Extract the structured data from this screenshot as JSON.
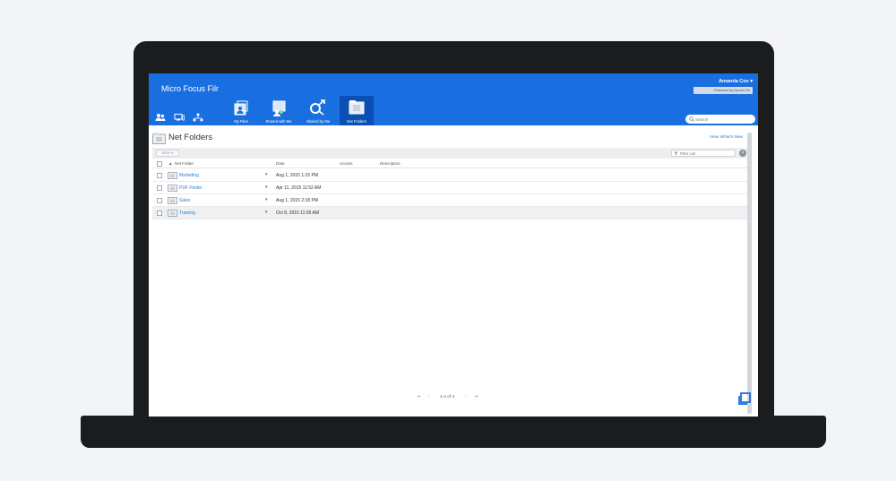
{
  "app": {
    "title": "Micro Focus Filr"
  },
  "user": {
    "name": "Amanda Cox ▾",
    "powered_by": "Powered by Novell Filr"
  },
  "nav_tabs": [
    {
      "label": "My Files",
      "icon": "my-files-icon"
    },
    {
      "label": "Shared with Me",
      "icon": "shared-with-me-icon"
    },
    {
      "label": "Shared by Me",
      "icon": "shared-by-me-icon"
    },
    {
      "label": "Net Folders",
      "icon": "net-folders-icon",
      "active": true
    }
  ],
  "search": {
    "placeholder": "Search"
  },
  "page": {
    "title": "Net Folders",
    "whats_new": "View What's New"
  },
  "toolbar": {
    "more_label": "More ▾",
    "filter_placeholder": "Filter List",
    "clear_label": "×"
  },
  "columns": {
    "sort_arrow": "▲",
    "name": "Net Folder",
    "date": "Date",
    "access": "Access",
    "description": "Description"
  },
  "rows": [
    {
      "name": "Marketing",
      "arrow": "▾",
      "date": "Aug 1, 2015 1:15 PM"
    },
    {
      "name": "PDF Finder",
      "arrow": "▾",
      "date": "Apr 11, 2015 11:52 AM"
    },
    {
      "name": "Sales",
      "arrow": "▾",
      "date": "Aug 1, 2015 2:18 PM"
    },
    {
      "name": "Training",
      "arrow": "▾",
      "date": "Oct 8, 2015 11:55 AM"
    }
  ],
  "pager": {
    "first": "⇤",
    "prev": "‹",
    "info": "1-4 of 4",
    "next": "›",
    "last": "⇥"
  },
  "colors": {
    "header_bg": "#1a6fe0",
    "active_tab": "#0a4fb5",
    "link": "#2a7ed8"
  }
}
